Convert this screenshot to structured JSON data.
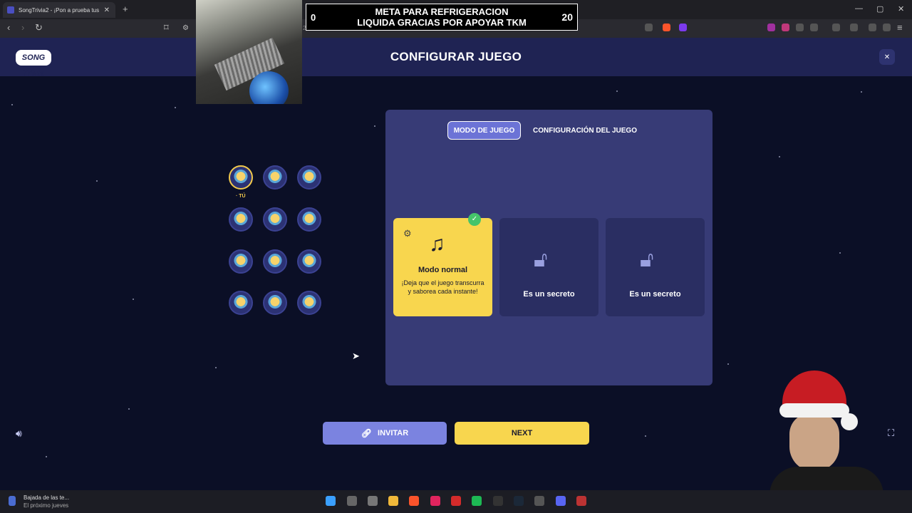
{
  "browser": {
    "tab_title": "SongTrivia2 - ¡Pon a prueba tus",
    "tab_close": "✕",
    "new_tab": "+",
    "url_fragment": "240211",
    "win_min": "—",
    "win_max": "▢",
    "win_close": "✕"
  },
  "stream_banner": {
    "left_count": "0",
    "title_line1": "META PARA REFRIGERACION",
    "title_line2": "LIQUIDA GRACIAS POR APOYAR TKM",
    "right_count": "20"
  },
  "header": {
    "logo": "SONG Trivia",
    "title": "CONFIGURAR JUEGO"
  },
  "players": {
    "you_label": "· TÚ"
  },
  "panel": {
    "tabs": [
      {
        "label": "MODO DE JUEGO",
        "active": true
      },
      {
        "label": "CONFIGURACIÓN DEL JUEGO",
        "active": false
      }
    ],
    "cards": [
      {
        "title": "Modo normal",
        "desc": "¡Deja que el juego transcurra y saborea cada instante!",
        "icon": "music-note-icon",
        "selected": true
      },
      {
        "title": "Es un secreto",
        "icon": "lock-icon"
      },
      {
        "title": "Es un secreto",
        "icon": "lock-icon"
      }
    ]
  },
  "buttons": {
    "invite": "INVITAR",
    "next": "NEXT"
  },
  "taskbar": {
    "notification_title": "Bajada de las te...",
    "notification_sub": "El próximo jueves"
  }
}
